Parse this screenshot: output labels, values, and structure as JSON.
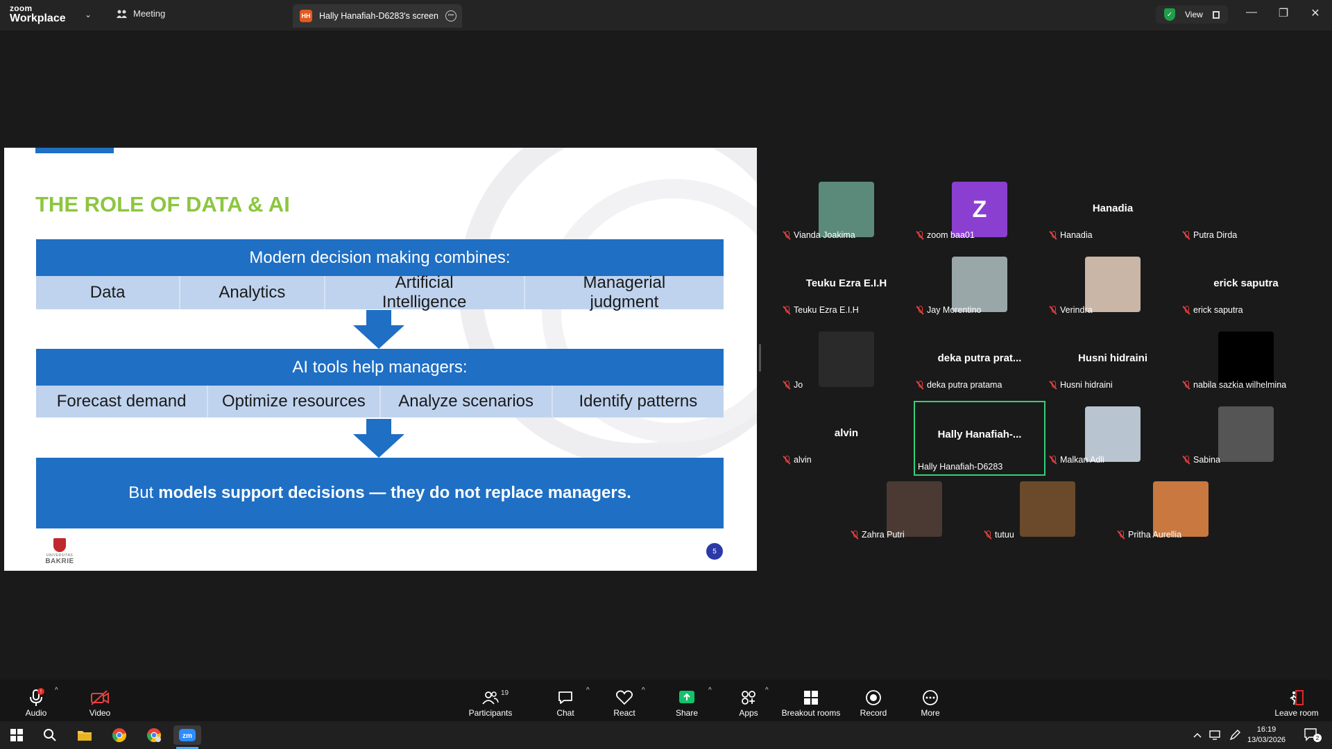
{
  "titlebar": {
    "logo_line1": "zoom",
    "logo_line2": "Workplace",
    "meeting_tab": "Meeting",
    "screen_tab_badge": "HH",
    "screen_tab": "Hally Hanafiah-D6283's screen",
    "view_label": "View"
  },
  "slide": {
    "title": "THE ROLE OF DATA & AI",
    "bar1": "Modern decision making combines:",
    "row1": [
      "Data",
      "Analytics",
      "Artificial Intelligence",
      "Managerial judgment"
    ],
    "bar2": "AI tools help managers:",
    "row2": [
      "Forecast demand",
      "Optimize resources",
      "Analyze scenarios",
      "Identify patterns"
    ],
    "bottom_prefix": "But",
    "bottom_bold": "models support decisions — they do not replace managers.",
    "logo_small": "UNIVERSITAS",
    "logo_big": "BAKRIE",
    "page_number": "5",
    "colors": {
      "title": "#8cc63f",
      "blue": "#1f6fc4",
      "row": "#bfd3ee"
    }
  },
  "participants": [
    {
      "label": "Vianda Joakima",
      "type": "video"
    },
    {
      "label": "zoom baa01",
      "type": "avatar",
      "avatar": "Z"
    },
    {
      "label": "Hanadia",
      "type": "name",
      "display": "Hanadia"
    },
    {
      "label": "Putra Dirda",
      "type": "video"
    },
    {
      "label": "Teuku Ezra E.I.H",
      "type": "name",
      "display": "Teuku Ezra E.I.H"
    },
    {
      "label": "Jay Morentino",
      "type": "video"
    },
    {
      "label": "Verindra",
      "type": "video"
    },
    {
      "label": "erick saputra",
      "type": "name",
      "display": "erick saputra"
    },
    {
      "label": "Jo",
      "type": "video"
    },
    {
      "label": "deka putra pratama",
      "type": "name",
      "display": "deka  putra  prat..."
    },
    {
      "label": "Husni hidraini",
      "type": "name",
      "display": "Husni hidraini"
    },
    {
      "label": "nabila sazkia wilhelmina",
      "type": "video"
    },
    {
      "label": "alvin",
      "type": "name",
      "display": "alvin"
    },
    {
      "label": "Hally Hanafiah-D6283",
      "type": "name",
      "display": "Hally  Hanafiah-...",
      "active": true
    },
    {
      "label": "Malkan Adli",
      "type": "video"
    },
    {
      "label": "Sabina",
      "type": "video"
    },
    {
      "label": "Zahra Putri",
      "type": "video"
    },
    {
      "label": "tutuu",
      "type": "video"
    },
    {
      "label": "Pritha Aurellia",
      "type": "video"
    }
  ],
  "toolbar": {
    "audio": "Audio",
    "video": "Video",
    "participants": "Participants",
    "participants_count": "19",
    "chat": "Chat",
    "react": "React",
    "share": "Share",
    "apps": "Apps",
    "breakout": "Breakout rooms",
    "record": "Record",
    "more": "More",
    "leave": "Leave room"
  },
  "taskbar": {
    "time": "16:19",
    "date": "13/03/2026",
    "notifications": "2"
  },
  "icons": [
    "windows-icon",
    "search-icon",
    "file-explorer-icon",
    "chrome-icon",
    "zoom-icon"
  ]
}
